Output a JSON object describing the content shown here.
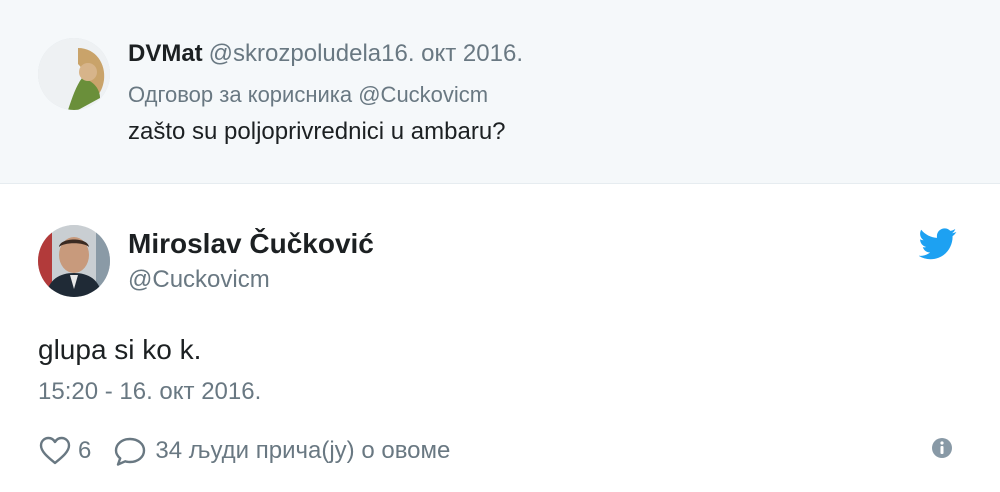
{
  "colors": {
    "parent_bg": "#f5f8fa",
    "muted": "#697882",
    "text": "#1c2022",
    "twitter_blue": "#1da1f2"
  },
  "parent_tweet": {
    "author_name": "DVMat",
    "handle": "@skrozpoludela",
    "date": "16. окт 2016.",
    "reply_to": "Одговор за корисника @Cuckovicm",
    "text": "zašto su poljoprivrednici u ambaru?"
  },
  "main_tweet": {
    "author_name": "Miroslav Čučković",
    "handle": "@Cuckovicm",
    "text": "glupa si ko k.",
    "timestamp": "15:20 - 16. окт 2016.",
    "like_count": "6",
    "conversation_text": "34 људи прича(ју) о овоме"
  },
  "icons": {
    "logo": "twitter-bird-icon",
    "like": "heart-icon",
    "reply": "comment-bubble-icon",
    "info": "info-icon"
  }
}
